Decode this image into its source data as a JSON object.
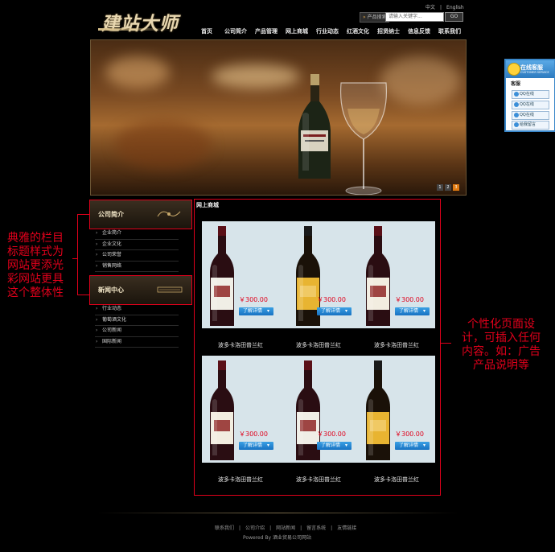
{
  "header": {
    "logo": "建站大师",
    "languages": [
      "中文",
      "|",
      "English"
    ],
    "search_label": "产品搜索",
    "search_placeholder": "请输入关键字...",
    "search_button": "GO"
  },
  "nav": {
    "items": [
      "首页",
      "公司简介",
      "产品管理",
      "网上商城",
      "行业动态",
      "红酒文化",
      "招贤纳士",
      "信息反馈",
      "联系我们"
    ]
  },
  "banner": {
    "controls": [
      "1",
      "2",
      "3"
    ]
  },
  "sidebar": {
    "company": {
      "title": "公司简介",
      "items": [
        "企业简介",
        "企业文化",
        "公司荣誉",
        "销售网络"
      ]
    },
    "news": {
      "title": "新闻中心",
      "items": [
        "行业动态",
        "葡萄酒文化",
        "公司新闻",
        "国际新闻"
      ]
    }
  },
  "annotations": {
    "left": [
      "典雅的栏目",
      "标题样式为",
      "网站更添光",
      "彩网站更具",
      "这个整体性"
    ],
    "right": [
      "个性化页面设",
      "计，可插入任何",
      "内容。如：广告",
      "产品说明等"
    ]
  },
  "main": {
    "title": "网上商城",
    "detail_label": "了解详情",
    "rows": [
      [
        {
          "name": "波多卡洛田普兰红",
          "price": "￥300.00",
          "label_color": "#f0eee6",
          "label_text": "BOURGOGNE"
        },
        {
          "name": "波多卡洛田普兰红",
          "price": "￥300.00",
          "label_color": "#e8b431",
          "label_text": "IRONY"
        },
        {
          "name": "波多卡洛田普兰红",
          "price": "￥300.00",
          "label_color": "#f2ede0",
          "label_text": "RAM"
        }
      ],
      [
        {
          "name": "波多卡洛田普兰红",
          "price": "￥300.00",
          "label_color": "#f2ede0",
          "label_text": "RAM"
        },
        {
          "name": "波多卡洛田普兰红",
          "price": "￥300.00",
          "label_color": "#f0eee6",
          "label_text": "BOURGOGNE"
        },
        {
          "name": "波多卡洛田普兰红",
          "price": "￥300.00",
          "label_color": "#e8b431",
          "label_text": "IRONY"
        }
      ]
    ]
  },
  "chat": {
    "title": "在线客服",
    "subtitle": "CUSTOMER SERVICE",
    "section": "客服",
    "lines": [
      "QQ在线",
      "QQ在线",
      "QQ在线",
      "给我留言"
    ]
  },
  "footer": {
    "links": [
      "联系我们",
      "|",
      "公司介绍",
      "|",
      "网站新闻",
      "|",
      "留言系统",
      "|",
      "友情链接"
    ],
    "powered": "Powered By 酒业贸易公司网站"
  },
  "colors": {
    "annotation_red": "#e0001b",
    "price_red": "#e0001b",
    "button_blue": "#1f7ed0",
    "panel_bg": "#d7e4ea"
  }
}
